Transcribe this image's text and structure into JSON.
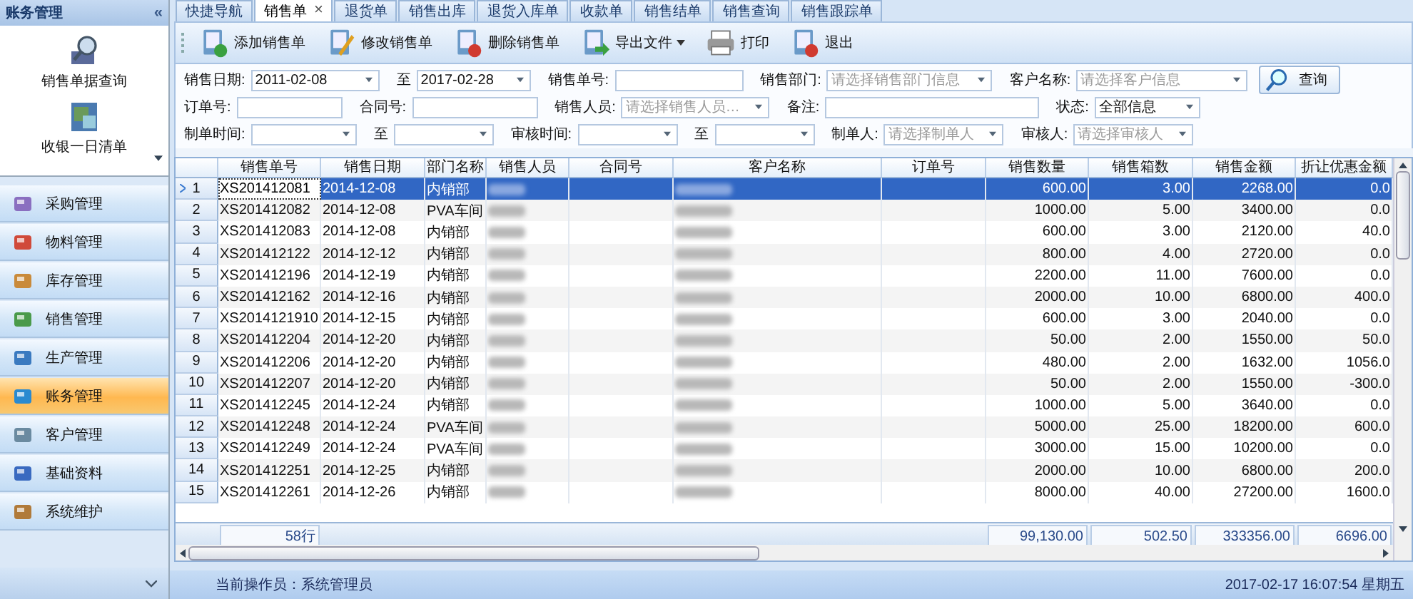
{
  "sidebar": {
    "title": "账务管理",
    "collapse": "«",
    "shortcuts": [
      {
        "label": "销售单据查询"
      },
      {
        "label": "收银一日清单"
      }
    ],
    "nav": [
      {
        "label": "采购管理",
        "selected": false
      },
      {
        "label": "物料管理",
        "selected": false
      },
      {
        "label": "库存管理",
        "selected": false
      },
      {
        "label": "销售管理",
        "selected": false
      },
      {
        "label": "生产管理",
        "selected": false
      },
      {
        "label": "账务管理",
        "selected": true
      },
      {
        "label": "客户管理",
        "selected": false
      },
      {
        "label": "基础资料",
        "selected": false
      },
      {
        "label": "系统维护",
        "selected": false
      }
    ]
  },
  "tabs": [
    {
      "label": "快捷导航",
      "selected": false,
      "closable": false
    },
    {
      "label": "销售单",
      "selected": true,
      "closable": true
    },
    {
      "label": "退货单",
      "selected": false,
      "closable": false
    },
    {
      "label": "销售出库",
      "selected": false,
      "closable": false
    },
    {
      "label": "退货入库单",
      "selected": false,
      "closable": false
    },
    {
      "label": "收款单",
      "selected": false,
      "closable": false
    },
    {
      "label": "销售结单",
      "selected": false,
      "closable": false
    },
    {
      "label": "销售查询",
      "selected": false,
      "closable": false
    },
    {
      "label": "销售跟踪单",
      "selected": false,
      "closable": false
    }
  ],
  "tab_close": "×",
  "toolbar": [
    {
      "label": "添加销售单",
      "kind": "add",
      "dropdown": false
    },
    {
      "label": "修改销售单",
      "kind": "edit",
      "dropdown": false
    },
    {
      "label": "删除销售单",
      "kind": "delete",
      "dropdown": false
    },
    {
      "label": "导出文件",
      "kind": "export",
      "dropdown": true
    },
    {
      "label": "打印",
      "kind": "print",
      "dropdown": false
    },
    {
      "label": "退出",
      "kind": "exit",
      "dropdown": false
    }
  ],
  "filters": [
    [
      {
        "label": "销售日期:",
        "kind": "combo",
        "value": "2011-02-08"
      },
      {
        "label": "至",
        "kind": "combo",
        "value": "2017-02-28"
      },
      {
        "label": "销售单号:",
        "kind": "text"
      },
      {
        "label": "销售部门:",
        "kind": "combo",
        "placeholder": "请选择销售部门信息"
      },
      {
        "label": "客户名称:",
        "kind": "combo",
        "placeholder": "请选择客户信息"
      }
    ],
    [
      {
        "label": "订单号:",
        "kind": "text"
      },
      {
        "label": "合同号:",
        "kind": "text"
      },
      {
        "label": "销售人员:",
        "kind": "combo",
        "placeholder": "请选择销售人员…"
      },
      {
        "label": "备注:",
        "kind": "text"
      },
      {
        "label": "状态:",
        "kind": "combo",
        "value": "全部信息"
      }
    ],
    [
      {
        "label": "制单时间:",
        "kind": "combo"
      },
      {
        "label": "至",
        "kind": "combo"
      },
      {
        "label": "审核时间:",
        "kind": "combo"
      },
      {
        "label": "至",
        "kind": "combo"
      },
      {
        "label": "制单人:",
        "kind": "combo",
        "placeholder": "请选择制单人"
      },
      {
        "label": "审核人:",
        "kind": "combo",
        "placeholder": "请选择审核人"
      }
    ]
  ],
  "query_button": "查询",
  "table": {
    "columns": [
      "销售单号",
      "销售日期",
      "部门名称",
      "销售人员",
      "合同号",
      "客户名称",
      "订单号",
      "销售数量",
      "销售箱数",
      "销售金额",
      "折让优惠金额"
    ],
    "rows": [
      {
        "n": "1",
        "selected": true,
        "cells": [
          "XS201412081",
          "2014-12-08",
          "内销部",
          null,
          "",
          null,
          "",
          "600.00",
          "3.00",
          "2268.00",
          "0.0"
        ]
      },
      {
        "n": "2",
        "selected": false,
        "cells": [
          "XS201412082",
          "2014-12-08",
          "PVA车间",
          null,
          "",
          null,
          "",
          "1000.00",
          "5.00",
          "3400.00",
          "0.0"
        ]
      },
      {
        "n": "3",
        "selected": false,
        "cells": [
          "XS201412083",
          "2014-12-08",
          "内销部",
          null,
          "",
          null,
          "",
          "600.00",
          "3.00",
          "2120.00",
          "40.0"
        ]
      },
      {
        "n": "4",
        "selected": false,
        "cells": [
          "XS201412122",
          "2014-12-12",
          "内销部",
          null,
          "",
          null,
          "",
          "800.00",
          "4.00",
          "2720.00",
          "0.0"
        ]
      },
      {
        "n": "5",
        "selected": false,
        "cells": [
          "XS201412196",
          "2014-12-19",
          "内销部",
          null,
          "",
          null,
          "",
          "2200.00",
          "11.00",
          "7600.00",
          "0.0"
        ]
      },
      {
        "n": "6",
        "selected": false,
        "cells": [
          "XS201412162",
          "2014-12-16",
          "内销部",
          null,
          "",
          null,
          "",
          "2000.00",
          "10.00",
          "6800.00",
          "400.0"
        ]
      },
      {
        "n": "7",
        "selected": false,
        "cells": [
          "XS2014121910",
          "2014-12-15",
          "内销部",
          null,
          "",
          null,
          "",
          "600.00",
          "3.00",
          "2040.00",
          "0.0"
        ]
      },
      {
        "n": "8",
        "selected": false,
        "cells": [
          "XS201412204",
          "2014-12-20",
          "内销部",
          null,
          "",
          null,
          "",
          "50.00",
          "2.00",
          "1550.00",
          "50.0"
        ]
      },
      {
        "n": "9",
        "selected": false,
        "cells": [
          "XS201412206",
          "2014-12-20",
          "内销部",
          null,
          "",
          null,
          "",
          "480.00",
          "2.00",
          "1632.00",
          "1056.0"
        ]
      },
      {
        "n": "10",
        "selected": false,
        "cells": [
          "XS201412207",
          "2014-12-20",
          "内销部",
          null,
          "",
          null,
          "",
          "50.00",
          "2.00",
          "1550.00",
          "-300.0"
        ]
      },
      {
        "n": "11",
        "selected": false,
        "cells": [
          "XS201412245",
          "2014-12-24",
          "内销部",
          null,
          "",
          null,
          "",
          "1000.00",
          "5.00",
          "3640.00",
          "0.0"
        ]
      },
      {
        "n": "12",
        "selected": false,
        "cells": [
          "XS201412248",
          "2014-12-24",
          "PVA车间",
          null,
          "",
          null,
          "",
          "5000.00",
          "25.00",
          "18200.00",
          "600.0"
        ]
      },
      {
        "n": "13",
        "selected": false,
        "cells": [
          "XS201412249",
          "2014-12-24",
          "PVA车间",
          null,
          "",
          null,
          "",
          "3000.00",
          "15.00",
          "10200.00",
          "0.0"
        ]
      },
      {
        "n": "14",
        "selected": false,
        "cells": [
          "XS201412251",
          "2014-12-25",
          "内销部",
          null,
          "",
          null,
          "",
          "2000.00",
          "10.00",
          "6800.00",
          "200.0"
        ]
      },
      {
        "n": "15",
        "selected": false,
        "cells": [
          "XS201412261",
          "2014-12-26",
          "内销部",
          null,
          "",
          null,
          "",
          "8000.00",
          "40.00",
          "27200.00",
          "1600.0"
        ]
      }
    ],
    "footer": {
      "count": "58行",
      "totals": [
        "99,130.00",
        "502.50",
        "333356.00",
        "6696.00"
      ]
    }
  },
  "status_bar": {
    "operator": "当前操作员：系统管理员",
    "datetime": "2017-02-17 16:07:54 星期五"
  }
}
